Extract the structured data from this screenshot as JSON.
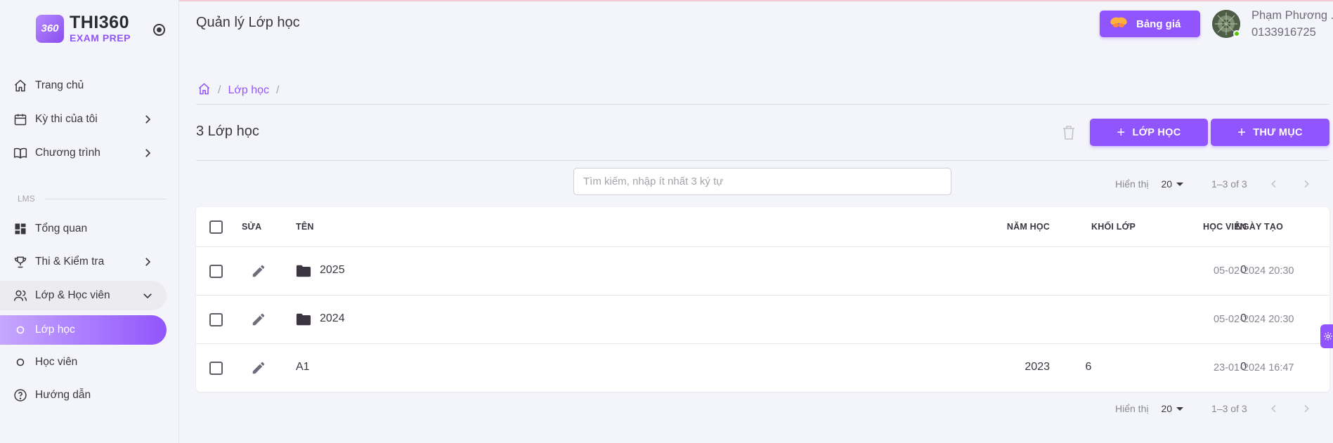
{
  "app": {
    "logo_mark": "360",
    "logo_title": "THI360",
    "logo_sub": "EXAM PREP"
  },
  "sidebar": {
    "section_label": "LMS",
    "items": [
      {
        "label": "Trang chủ",
        "icon": "home-icon"
      },
      {
        "label": "Kỳ thi của tôi",
        "icon": "calendar-icon"
      },
      {
        "label": "Chương trình",
        "icon": "book-icon"
      },
      {
        "label": "Tổng quan",
        "icon": "dashboard-icon"
      },
      {
        "label": "Thi & Kiểm tra",
        "icon": "trophy-icon"
      },
      {
        "label": "Lớp & Học viên",
        "icon": "users-icon"
      },
      {
        "label": "Lớp học",
        "icon": "circle-icon"
      },
      {
        "label": "Học viên",
        "icon": "circle-icon"
      },
      {
        "label": "Hướng dẫn",
        "icon": "help-icon"
      }
    ]
  },
  "header": {
    "title": "Quản lý Lớp học",
    "pricing_label": "Bảng giá",
    "user_name": "Phạm Phương .",
    "user_phone": "0133916725"
  },
  "breadcrumb": {
    "current": "Lớp học",
    "sep": "/"
  },
  "toolbar": {
    "count_title": "3 Lớp học",
    "add_class_label": "LỚP HỌC",
    "add_folder_label": "THƯ MỤC",
    "search_placeholder": "Tìm kiếm, nhập ít nhất 3 ký tự"
  },
  "pagination": {
    "label": "Hiển thị",
    "per_page": "20",
    "range": "1–3 of 3"
  },
  "table": {
    "headers": {
      "edit": "SỬA",
      "name": "TÊN",
      "year": "NĂM HỌC",
      "grade": "KHỐI LỚP",
      "students": "HỌC VIÊN",
      "created": "NGÀY TẠO"
    },
    "rows": [
      {
        "name": "2025",
        "is_folder": true,
        "year": "",
        "grade": "",
        "students": "0",
        "created": "05-02-2024 20:30"
      },
      {
        "name": "2024",
        "is_folder": true,
        "year": "",
        "grade": "",
        "students": "0",
        "created": "05-02-2024 20:30"
      },
      {
        "name": "A1",
        "is_folder": false,
        "year": "2023",
        "grade": "6",
        "students": "0",
        "created": "23-01-2024 16:47"
      }
    ]
  },
  "colors": {
    "accent": "#9155fd",
    "text": "#3a3541",
    "muted": "#8a8893",
    "online": "#56ca00"
  }
}
